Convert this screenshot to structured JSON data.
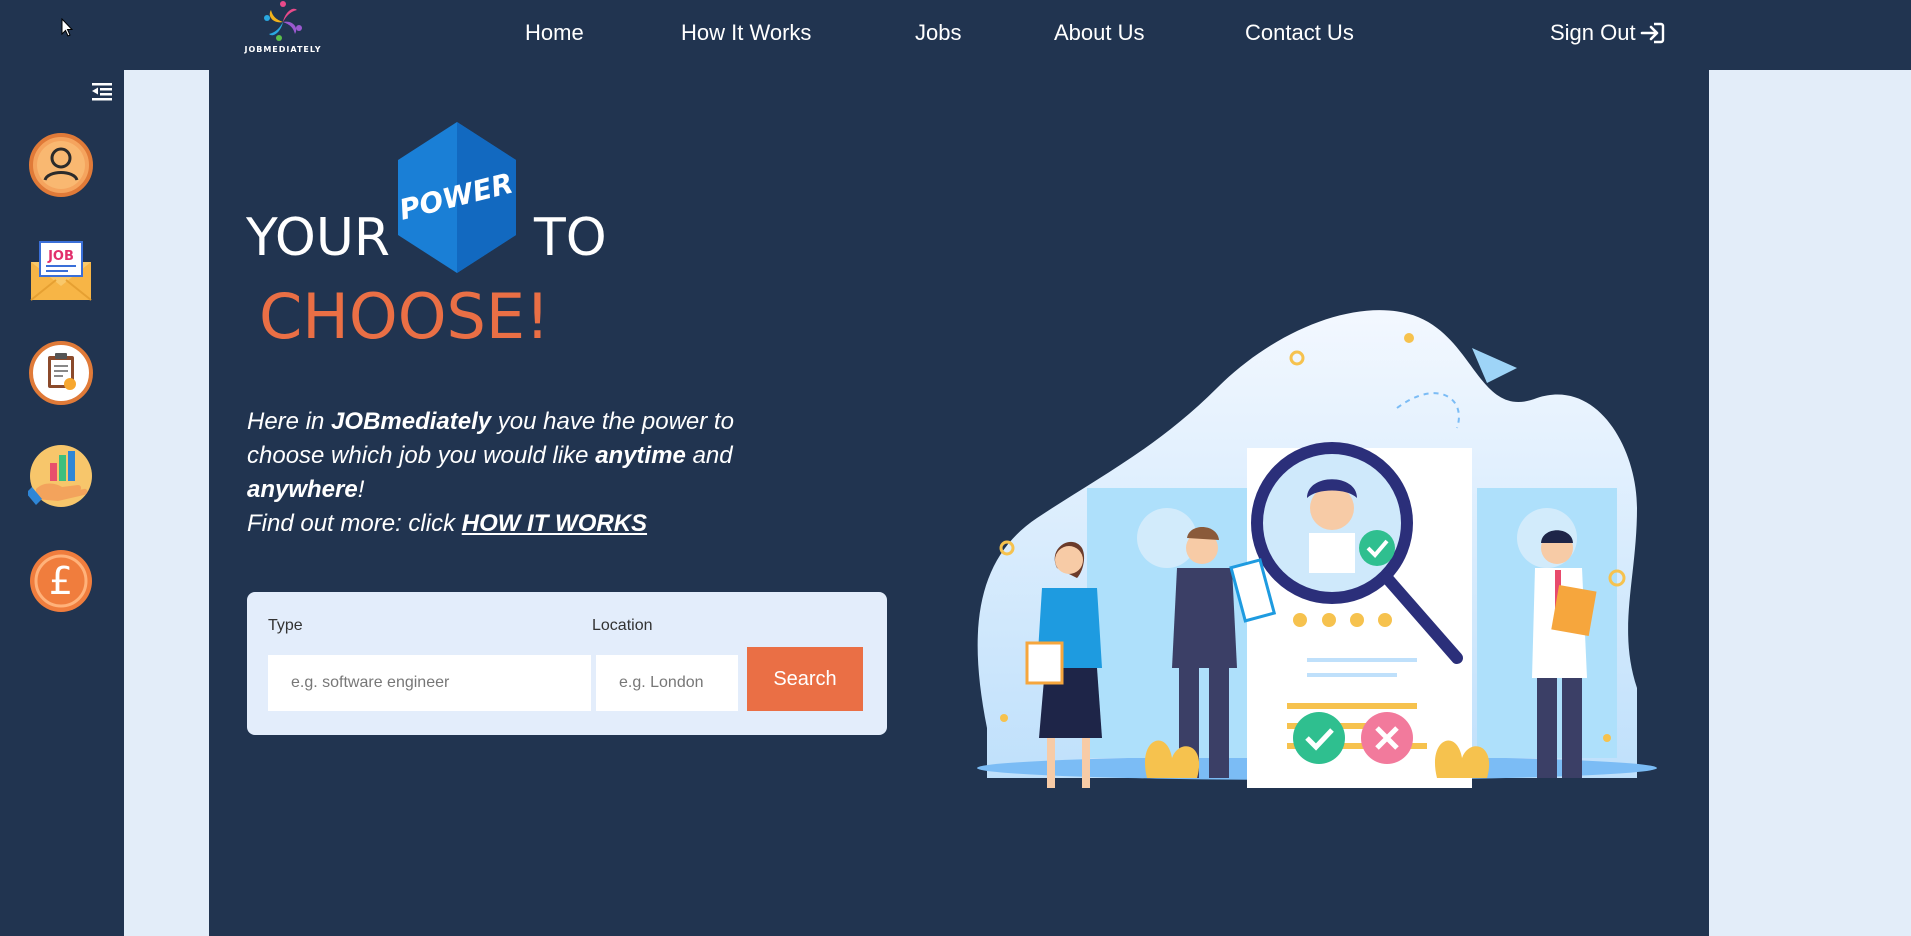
{
  "brand": {
    "name": "JOBMEDIATELY"
  },
  "nav": {
    "items": [
      {
        "label": "Home"
      },
      {
        "label": "How It Works"
      },
      {
        "label": "Jobs"
      },
      {
        "label": "About Us"
      },
      {
        "label": "Contact Us"
      }
    ],
    "signout_label": "Sign Out"
  },
  "sidebar": {
    "items": [
      {
        "icon": "user-icon"
      },
      {
        "icon": "job-mail-icon"
      },
      {
        "icon": "clipboard-icon"
      },
      {
        "icon": "chart-hand-icon"
      },
      {
        "icon": "pound-icon"
      }
    ]
  },
  "hero": {
    "your": "YOUR",
    "power": "POWER",
    "to": "TO",
    "choose": "CHOOSE!",
    "desc_1": "Here in ",
    "desc_brand": "JOBmediately",
    "desc_2": " you have the power to choose which job you would like ",
    "desc_anytime": "anytime",
    "desc_3": " and ",
    "desc_anywhere": "anywhere",
    "desc_4": "!",
    "desc_5": "Find out more: click ",
    "desc_link": "HOW IT WORKS"
  },
  "search": {
    "type_label": "Type",
    "type_placeholder": "e.g. software engineer",
    "location_label": "Location",
    "location_placeholder": "e.g. London",
    "button_label": "Search"
  },
  "colors": {
    "background": "#213450",
    "accent": "#ea6f45",
    "panel": "#e3edf9",
    "power_blue": "#1a7fd6"
  }
}
